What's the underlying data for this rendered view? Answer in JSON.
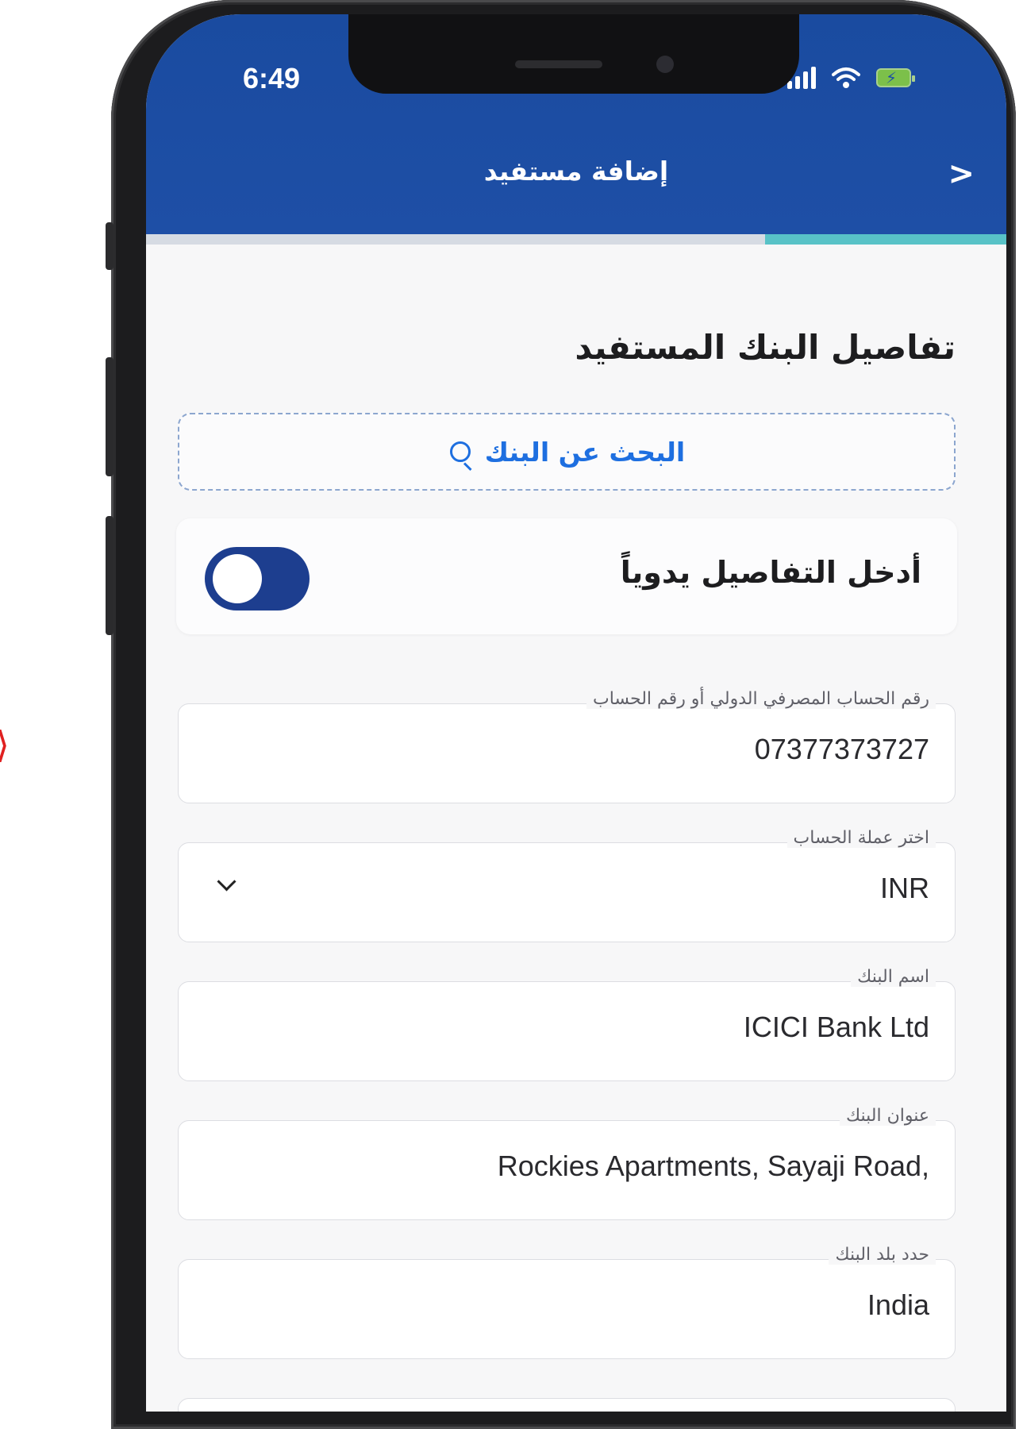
{
  "status_bar": {
    "time": "6:49"
  },
  "header": {
    "title": "إضافة مستفيد",
    "back_icon": "chevron-right-icon"
  },
  "progress": {
    "fraction": 0.28
  },
  "section": {
    "title": "تفاصيل البنك المستفيد"
  },
  "search": {
    "label": "البحث عن البنك",
    "icon": "search-icon"
  },
  "manual_entry": {
    "label": "أدخل التفاصيل يدوياً",
    "enabled": true
  },
  "fields": {
    "iban": {
      "label": "رقم الحساب المصرفي الدولي أو رقم الحساب",
      "value": "07377373727"
    },
    "currency": {
      "label": "اختر عملة الحساب",
      "value": "INR"
    },
    "bank_name": {
      "label": "اسم البنك",
      "value": "ICICI Bank Ltd"
    },
    "bank_address": {
      "label": "عنوان البنك",
      "value": "Rockies Apartments, Sayaji Road,"
    },
    "bank_country": {
      "label": "حدد بلد البنك",
      "value": "India"
    }
  },
  "colors": {
    "header": "#1e4fa6",
    "accent": "#58c2c7",
    "link": "#1e6fe0",
    "toggle": "#1d3e8f"
  }
}
